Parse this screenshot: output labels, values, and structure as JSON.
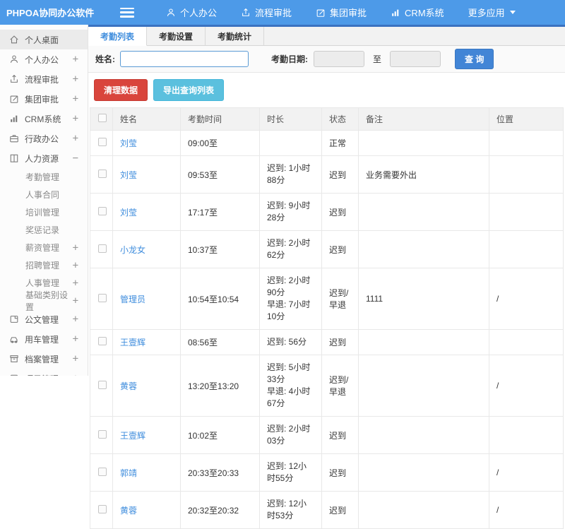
{
  "header": {
    "logo": "PHPOA协同办公软件",
    "nav": [
      {
        "label": "个人办公",
        "icon": "user-icon"
      },
      {
        "label": "流程审批",
        "icon": "share-icon"
      },
      {
        "label": "集团审批",
        "icon": "edit-icon"
      },
      {
        "label": "CRM系统",
        "icon": "chart-icon"
      },
      {
        "label": "更多应用",
        "icon": "caret-down-icon",
        "icon_after": true
      }
    ]
  },
  "sidebar": {
    "items": [
      {
        "label": "个人桌面",
        "icon": "home-icon",
        "active": true,
        "toggle": ""
      },
      {
        "label": "个人办公",
        "icon": "user-icon",
        "toggle": "+"
      },
      {
        "label": "流程审批",
        "icon": "share-icon",
        "toggle": "+"
      },
      {
        "label": "集团审批",
        "icon": "edit-icon",
        "toggle": "+"
      },
      {
        "label": "CRM系统",
        "icon": "chart-icon",
        "toggle": "+"
      },
      {
        "label": "行政办公",
        "icon": "briefcase-icon",
        "toggle": "+"
      },
      {
        "label": "人力资源",
        "icon": "book-icon",
        "toggle": "−",
        "children": [
          {
            "label": "考勤管理",
            "toggle": ""
          },
          {
            "label": "人事合同",
            "toggle": ""
          },
          {
            "label": "培训管理",
            "toggle": ""
          },
          {
            "label": "奖惩记录",
            "toggle": ""
          },
          {
            "label": "薪资管理",
            "toggle": "+"
          },
          {
            "label": "招聘管理",
            "toggle": "+"
          },
          {
            "label": "人事管理",
            "toggle": "+"
          },
          {
            "label": "基础类别设置",
            "toggle": "+"
          }
        ]
      },
      {
        "label": "公文管理",
        "icon": "doc-icon",
        "toggle": "+"
      },
      {
        "label": "用车管理",
        "icon": "car-icon",
        "toggle": "+"
      },
      {
        "label": "档案管理",
        "icon": "archive-icon",
        "toggle": "+"
      },
      {
        "label": "项目管理",
        "icon": "clipboard-icon",
        "toggle": "+"
      }
    ]
  },
  "tabs": [
    {
      "label": "考勤列表",
      "active": true
    },
    {
      "label": "考勤设置",
      "active": false
    },
    {
      "label": "考勤统计",
      "active": false
    }
  ],
  "filter": {
    "name_label": "姓名:",
    "name_value": "",
    "date_label": "考勤日期:",
    "date_from_value": "",
    "to_label": "至",
    "date_to_value": "",
    "search_button": "查 询"
  },
  "actions": {
    "clear_button": "清理数据",
    "export_button": "导出查询列表"
  },
  "table": {
    "columns": [
      "姓名",
      "考勤时间",
      "时长",
      "状态",
      "备注",
      "位置"
    ],
    "rows": [
      {
        "name": "刘莹",
        "time": "09:00至",
        "duration": [],
        "status": "正常",
        "status_type": "normal",
        "note": "",
        "location": ""
      },
      {
        "name": "刘莹",
        "time": "09:53至",
        "duration": [
          "迟到: 1小时88分"
        ],
        "status": "迟到",
        "status_type": "late",
        "note": "业务需要外出",
        "location": ""
      },
      {
        "name": "刘莹",
        "time": "17:17至",
        "duration": [
          "迟到: 9小时28分"
        ],
        "status": "迟到",
        "status_type": "late",
        "note": "",
        "location": ""
      },
      {
        "name": "小龙女",
        "time": "10:37至",
        "duration": [
          "迟到: 2小时62分"
        ],
        "status": "迟到",
        "status_type": "late",
        "note": "",
        "location": ""
      },
      {
        "name": "管理员",
        "time": "10:54至10:54",
        "duration": [
          "迟到: 2小时90分",
          "早退: 7小时10分"
        ],
        "status": "迟到/早退",
        "status_type": "late",
        "note": "1111",
        "location": "/"
      },
      {
        "name": "王壹辉",
        "time": "08:56至",
        "duration": [
          "迟到: 56分"
        ],
        "status": "迟到",
        "status_type": "late",
        "note": "",
        "location": ""
      },
      {
        "name": "黄蓉",
        "time": "13:20至13:20",
        "duration": [
          "迟到: 5小时33分",
          "早退: 4小时67分"
        ],
        "status": "迟到/早退",
        "status_type": "late",
        "note": "",
        "location": "/"
      },
      {
        "name": "王壹辉",
        "time": "10:02至",
        "duration": [
          "迟到: 2小时03分"
        ],
        "status": "迟到",
        "status_type": "late",
        "note": "",
        "location": ""
      },
      {
        "name": "郭靖",
        "time": "20:33至20:33",
        "duration": [
          "迟到: 12小时55分"
        ],
        "status": "迟到",
        "status_type": "late",
        "note": "",
        "location": "/"
      },
      {
        "name": "黄蓉",
        "time": "20:32至20:32",
        "duration": [
          "迟到: 12小时53分"
        ],
        "status": "迟到",
        "status_type": "late",
        "note": "",
        "location": "/"
      }
    ]
  },
  "colors": {
    "topbar_blue": "#4d9ae8",
    "tab_accent_blue": "#3a72c0",
    "link_blue": "#3f8ddd",
    "search_button_blue": "#4285d6",
    "danger_red": "#d9453c",
    "info_teal": "#5bc0de",
    "status_red": "#d9453c"
  }
}
